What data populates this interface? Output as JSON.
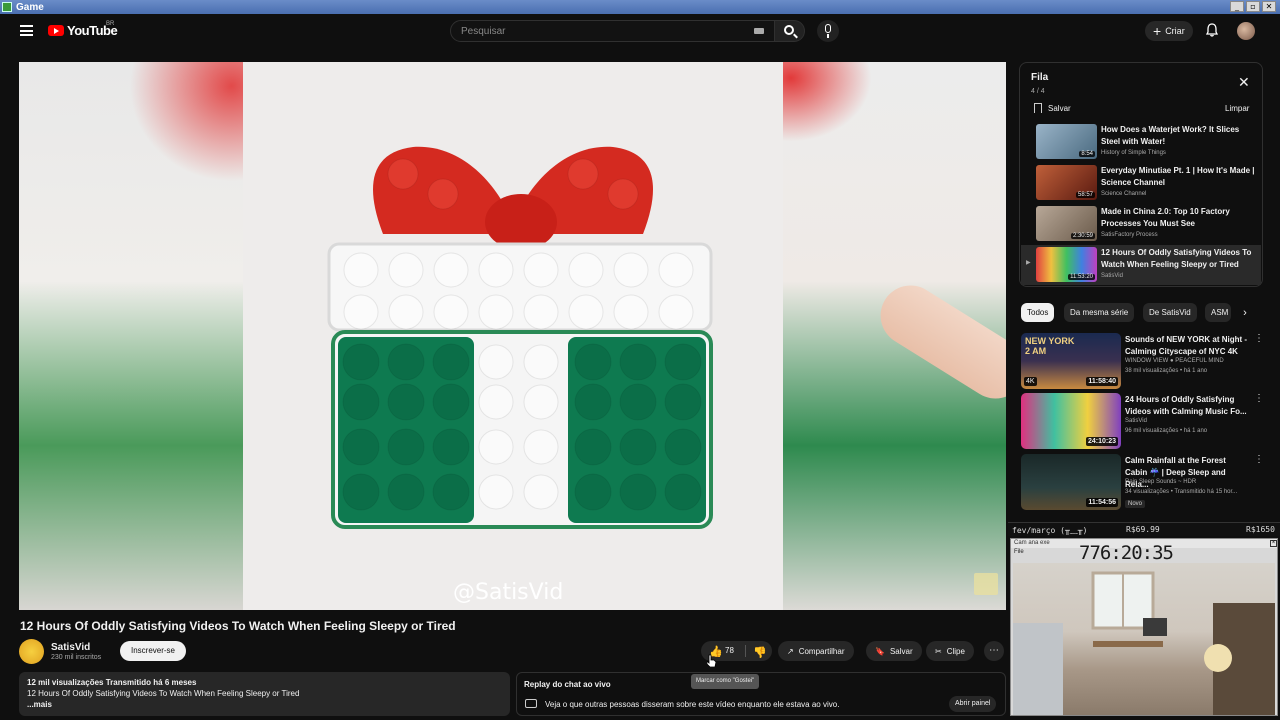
{
  "window": {
    "title": "Game",
    "buttons": [
      "_",
      "▫",
      "✕"
    ]
  },
  "masthead": {
    "logo_text": "YouTube",
    "region": "BR",
    "search_placeholder": "Pesquisar",
    "create_label": "Criar"
  },
  "video": {
    "watermark": "@SatisVid",
    "title": "12 Hours Of Oddly Satisfying Videos To Watch When Feeling Sleepy or Tired",
    "channel": "SatisVid",
    "subscribers": "230 mil inscritos",
    "subscribe_label": "Inscrever-se",
    "likes": "78",
    "share_label": "Compartilhar",
    "save_label": "Salvar",
    "clip_label": "Clipe",
    "like_tooltip": "Marcar como \"Gostei\""
  },
  "description": {
    "stats": "12 mil visualizações  Transmitido há 6 meses",
    "text": "12 Hours Of Oddly Satisfying Videos To Watch When Feeling Sleepy or Tired",
    "more": "...mais"
  },
  "chat": {
    "title": "Replay do chat ao vivo",
    "text": "Veja o que outras pessoas disseram sobre este vídeo enquanto ele estava ao vivo.",
    "open_label": "Abrir painel"
  },
  "queue": {
    "title": "Fila",
    "count": "4 / 4",
    "save_label": "Salvar",
    "clear_label": "Limpar",
    "items": [
      {
        "title": "How Does a Waterjet Work? It Slices Steel with Water!",
        "channel": "History of Simple Things",
        "duration": "8:54",
        "color": "#7a9ab0"
      },
      {
        "title": "Everyday Minutiae Pt. 1 | How It's Made | Science Channel",
        "channel": "Science Channel",
        "duration": "58:57",
        "color": "#8a3a2a"
      },
      {
        "title": "Made in China 2.0: Top 10 Factory Processes You Must See",
        "channel": "SatisFactory Process",
        "duration": "2:30:59",
        "color": "#9a8a7a"
      },
      {
        "title": "12 Hours Of Oddly Satisfying Videos To Watch When Feeling Sleepy or Tired",
        "channel": "SatisVid",
        "duration": "11:53:20",
        "color": "#c050a0"
      }
    ]
  },
  "chips": [
    "Todos",
    "Da mesma série",
    "De SatisVid",
    "ASM"
  ],
  "recommendations": [
    {
      "title": "Sounds of NEW YORK at Night - Calming Cityscape of NYC 4K",
      "channel": "WINDOW VIEW ● PEACEFUL MIND",
      "meta": "38 mil visualizações • há 1 ano",
      "duration": "11:58:40",
      "thumb_label": "NEW YORK 2 AM",
      "badge": "4K",
      "new": "",
      "color": "#1a2a4a"
    },
    {
      "title": "24 Hours of Oddly Satisfying Videos with Calming Music Fo...",
      "channel": "SatisVid",
      "meta": "96 mil visualizações • há 1 ano",
      "duration": "24:10:23",
      "thumb_label": "",
      "badge": "",
      "new": "",
      "color": "#b03a8a"
    },
    {
      "title": "Calm Rainfall at the Forest Cabin ☔ | Deep Sleep and Rela...",
      "channel": "Rain Sleep Sounds ~ HDR",
      "meta": "34 visualizações • Transmitido há 15 hor...",
      "duration": "11:54:56",
      "thumb_label": "",
      "badge": "",
      "new": "Novo",
      "color": "#2a3a3a"
    }
  ],
  "overlay": {
    "label": "fev/março (╥﹏╥)",
    "amount1": "R$69.99",
    "amount2": "R$1650",
    "cam_title": "Cam ana exe",
    "cam_menu": "File",
    "timer": "776:20:35"
  }
}
